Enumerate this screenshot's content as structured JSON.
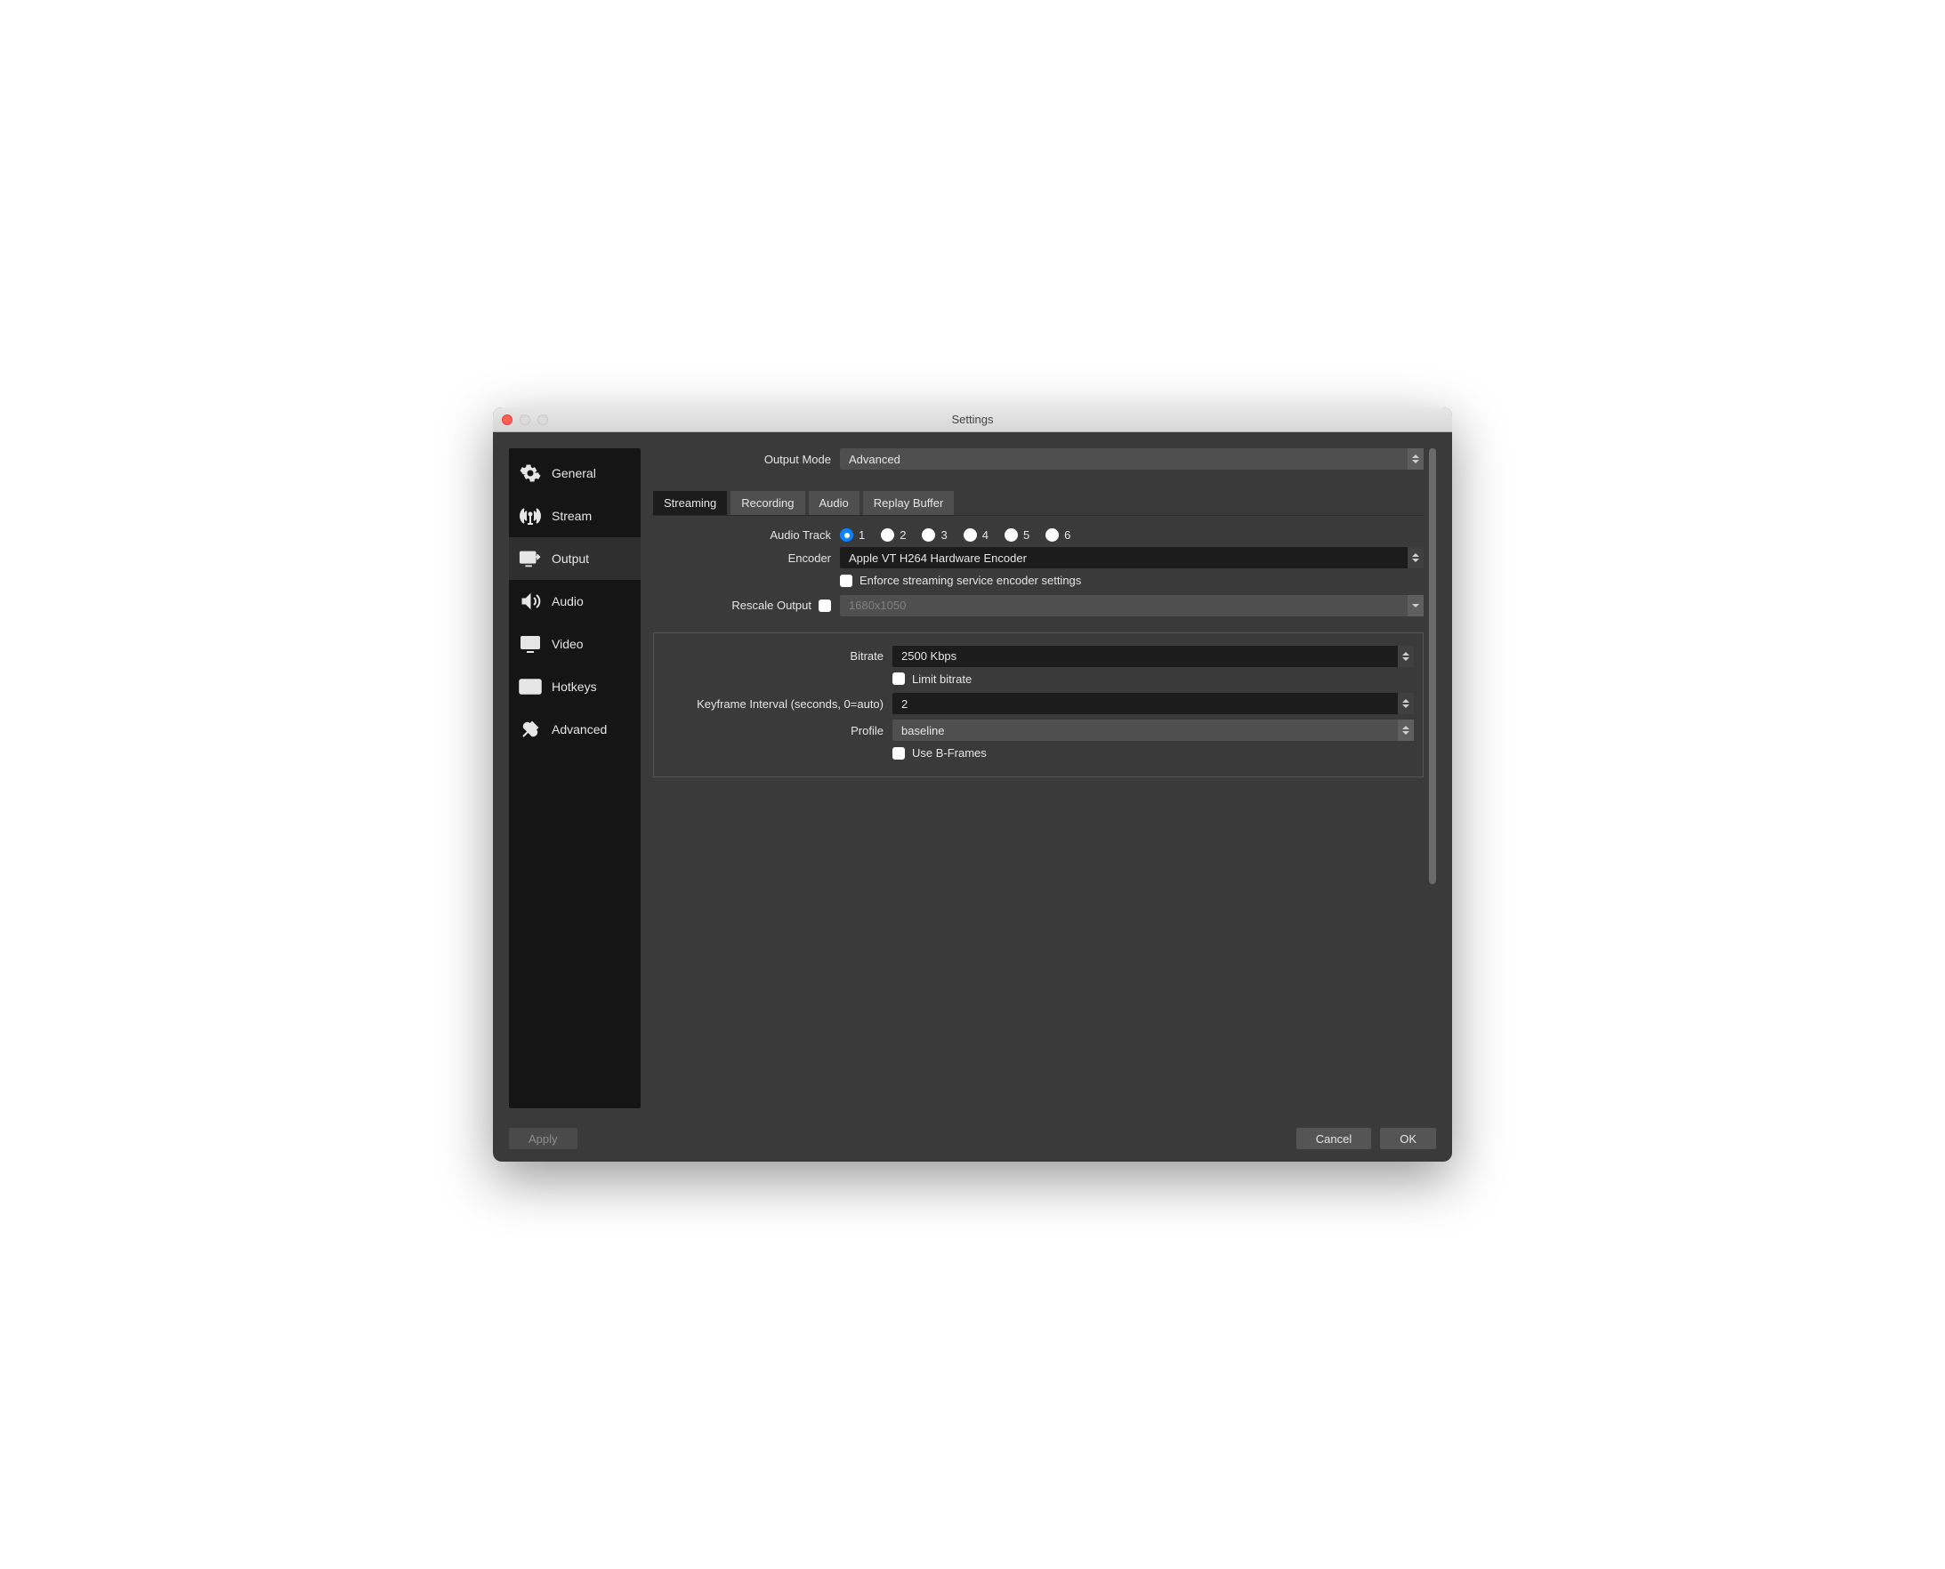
{
  "window": {
    "title": "Settings"
  },
  "sidebar": {
    "items": [
      {
        "label": "General"
      },
      {
        "label": "Stream"
      },
      {
        "label": "Output"
      },
      {
        "label": "Audio"
      },
      {
        "label": "Video"
      },
      {
        "label": "Hotkeys"
      },
      {
        "label": "Advanced"
      }
    ],
    "active_index": 2
  },
  "output_mode": {
    "label": "Output Mode",
    "value": "Advanced"
  },
  "tabs": {
    "items": [
      "Streaming",
      "Recording",
      "Audio",
      "Replay Buffer"
    ],
    "active_index": 0
  },
  "streaming": {
    "audio_track_label": "Audio Track",
    "audio_track_options": [
      "1",
      "2",
      "3",
      "4",
      "5",
      "6"
    ],
    "audio_track_selected": 0,
    "encoder_label": "Encoder",
    "encoder_value": "Apple VT H264 Hardware Encoder",
    "enforce_label": "Enforce streaming service encoder settings",
    "enforce_checked": false,
    "rescale_label": "Rescale Output",
    "rescale_checked": false,
    "rescale_value": "1680x1050"
  },
  "encoder_settings": {
    "bitrate_label": "Bitrate",
    "bitrate_value": "2500 Kbps",
    "limit_bitrate_label": "Limit bitrate",
    "limit_bitrate_checked": false,
    "keyframe_label": "Keyframe Interval (seconds, 0=auto)",
    "keyframe_value": "2",
    "profile_label": "Profile",
    "profile_value": "baseline",
    "bframes_label": "Use B-Frames",
    "bframes_checked": false
  },
  "footer": {
    "apply": "Apply",
    "cancel": "Cancel",
    "ok": "OK"
  }
}
